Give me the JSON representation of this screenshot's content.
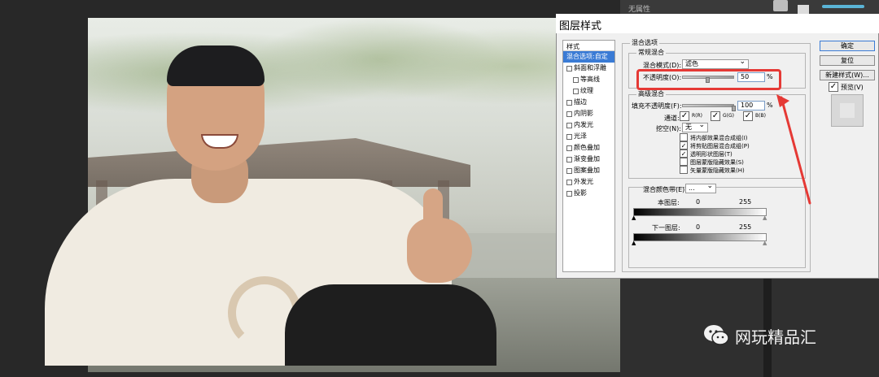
{
  "right_panel": {
    "title": "无属性"
  },
  "dialog": {
    "title": "图层样式",
    "styles_header": "样式",
    "styles": [
      {
        "label": "混合选项:自定",
        "selected": true
      },
      {
        "label": "斜面和浮雕"
      },
      {
        "label": "等高线",
        "indent": true
      },
      {
        "label": "纹理",
        "indent": true
      },
      {
        "label": "描边"
      },
      {
        "label": "内阴影"
      },
      {
        "label": "内发光"
      },
      {
        "label": "光泽"
      },
      {
        "label": "颜色叠加"
      },
      {
        "label": "渐变叠加"
      },
      {
        "label": "图案叠加"
      },
      {
        "label": "外发光"
      },
      {
        "label": "投影"
      }
    ],
    "blend_options_label": "混合选项",
    "general_blend_label": "常规混合",
    "blend_mode_label": "混合模式(D):",
    "blend_mode_value": "滤色",
    "opacity_label": "不透明度(O):",
    "opacity_value": "50",
    "percent": "%",
    "advanced_label": "高级混合",
    "fill_opacity_label": "填充不透明度(F):",
    "fill_opacity_value": "100",
    "channels_label": "通道:",
    "channel_r": "R(R)",
    "channel_g": "G(G)",
    "channel_b": "B(B)",
    "knockout_label": "挖空(N):",
    "knockout_value": "无",
    "options": [
      {
        "label": "将内部效果混合成组(I)",
        "checked": false
      },
      {
        "label": "将剪贴图层混合成组(P)",
        "checked": true
      },
      {
        "label": "透明形状图层(T)",
        "checked": true
      },
      {
        "label": "图层蒙版隐藏效果(S)",
        "checked": false
      },
      {
        "label": "矢量蒙版隐藏效果(H)",
        "checked": false
      }
    ],
    "blend_if_label": "混合颜色带(E):",
    "blend_if_value": "...",
    "this_layer_label": "本图层:",
    "underlying_label": "下一图层:",
    "range_min": "0",
    "range_max": "255",
    "ok_button": "确定",
    "reset_button": "复位",
    "new_style_button": "新建样式(W)...",
    "preview_label": "预览(V)"
  },
  "watermark": {
    "text": "网玩精品汇"
  },
  "colors": {
    "annotation": "#e53935",
    "selection": "#3a7bd5"
  }
}
